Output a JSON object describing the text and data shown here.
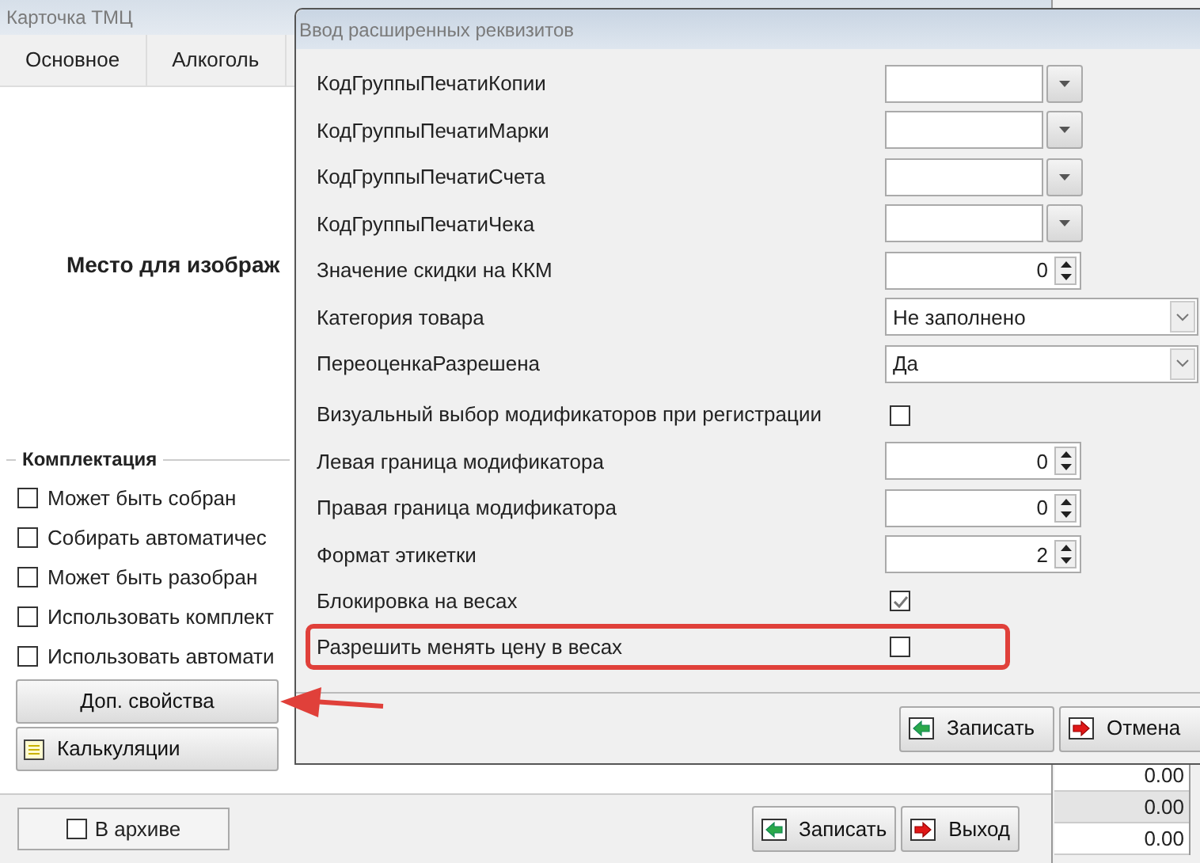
{
  "main_window": {
    "title": "Карточка ТМЦ",
    "tabs": [
      "Основное",
      "Алкоголь"
    ],
    "image_placeholder": "Место для изображ",
    "group": {
      "title": "Комплектация",
      "options": [
        {
          "label": "Может быть собран",
          "checked": false
        },
        {
          "label": "Собирать автоматичес",
          "checked": false
        },
        {
          "label": "Может быть разобран",
          "checked": false
        },
        {
          "label": "Использовать комплект",
          "checked": false
        },
        {
          "label": "Использовать автомати",
          "checked": false
        }
      ]
    },
    "buttons": [
      {
        "label": "Доп. свойства",
        "kind": "plain"
      },
      {
        "label": "Калькуляции",
        "kind": "list"
      }
    ],
    "archive": {
      "label": "В архиве",
      "checked": false
    },
    "footer_buttons": [
      {
        "label": "Записать",
        "kind": "save"
      },
      {
        "label": "Выход",
        "kind": "exit"
      }
    ]
  },
  "side_table": {
    "rows": [
      "0.00",
      "0.00",
      "0.00"
    ]
  },
  "dialog": {
    "title": "Ввод расширенных реквизитов",
    "fields": [
      {
        "label": "КодГруппыПечатиКопии",
        "kind": "combo",
        "highlighted": false
      },
      {
        "label": "КодГруппыПечатиМарки",
        "kind": "combo",
        "highlighted": false
      },
      {
        "label": "КодГруппыПечатиСчета",
        "kind": "combo",
        "highlighted": false
      },
      {
        "label": "КодГруппыПечатиЧека",
        "kind": "combo",
        "highlighted": false
      },
      {
        "label": "Значение скидки на ККМ",
        "kind": "spin",
        "value": "0",
        "highlighted": false
      },
      {
        "label": "Категория товара",
        "kind": "select",
        "value": "Не заполнено",
        "highlighted": false
      },
      {
        "label": "ПереоценкаРазрешена",
        "kind": "select",
        "value": "Да",
        "highlighted": false
      },
      {
        "label": "Визуальный выбор модификаторов при регистрации",
        "kind": "checkbox",
        "checked": false,
        "highlighted": false
      },
      {
        "label": "Левая граница модификатора",
        "kind": "spin",
        "value": "0",
        "highlighted": false
      },
      {
        "label": "Правая граница модификатора",
        "kind": "spin",
        "value": "0",
        "highlighted": false
      },
      {
        "label": "Формат этикетки",
        "kind": "spin",
        "value": "2",
        "highlighted": false
      },
      {
        "label": "Блокировка на весах",
        "kind": "checkbox",
        "checked": true,
        "highlighted": false
      },
      {
        "label": "Разрешить менять цену в весах",
        "kind": "checkbox",
        "checked": false,
        "highlighted": true
      }
    ],
    "buttons": [
      {
        "label": "Записать",
        "kind": "save"
      },
      {
        "label": "Отмена",
        "kind": "exit"
      }
    ]
  }
}
